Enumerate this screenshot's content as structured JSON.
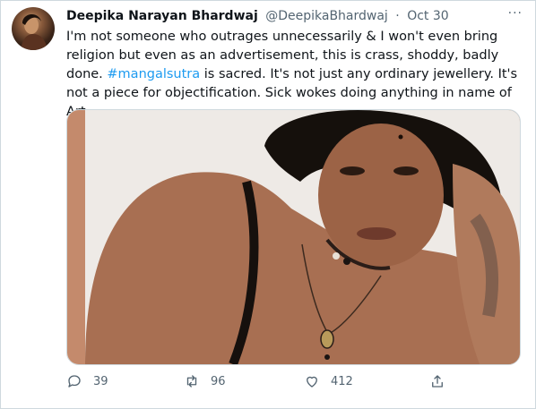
{
  "author": {
    "name": "Deepika Narayan Bhardwaj",
    "handle": "@DeepikaBhardwaj",
    "separator": "·",
    "date": "Oct 30"
  },
  "more_label": "···",
  "text": {
    "part1": "I'm not someone who outrages unnecessarily & I won't even bring religion but even as an advertisement, this is crass, shoddy, badly done. ",
    "hashtag": "#mangalsutra",
    "part2": " is sacred. It's not just any ordinary jewellery. It's not a piece for objectification. Sick wokes doing anything in name of Art"
  },
  "actions": {
    "reply_count": "39",
    "retweet_count": "96",
    "like_count": "412"
  },
  "colors": {
    "link": "#1d9bf0",
    "secondary_text": "#536471",
    "border": "#cfd9de"
  },
  "icons": [
    "reply-icon",
    "retweet-icon",
    "like-icon",
    "share-icon",
    "more-icon"
  ]
}
